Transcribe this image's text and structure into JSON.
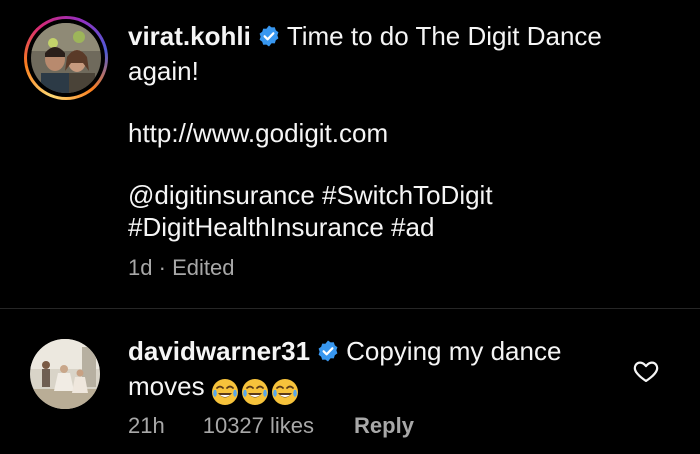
{
  "post": {
    "username": "virat.kohli",
    "caption_line1": "Time to do The Digit Dance",
    "caption_line2": "again!",
    "link": "http://www.godigit.com",
    "tags_line1": "@digitinsurance #SwitchToDigit",
    "tags_line2": "#DigitHealthInsurance #ad",
    "time": "1d",
    "separator": "·",
    "edited": "Edited"
  },
  "comment": {
    "username": "davidwarner31",
    "text_line1": "Copying my dance",
    "text_line2": "moves",
    "emoji_icon": "joy-emoji-icon",
    "emoji_count": 3,
    "time": "21h",
    "likes": "10327 likes",
    "reply_label": "Reply"
  },
  "icons": {
    "verified": "verified-badge-icon",
    "like": "heart-icon"
  },
  "colors": {
    "background": "#000000",
    "text": "#f5f5f5",
    "muted": "#a8a8a8",
    "verified_blue": "#3897f0",
    "divider": "#262626"
  }
}
